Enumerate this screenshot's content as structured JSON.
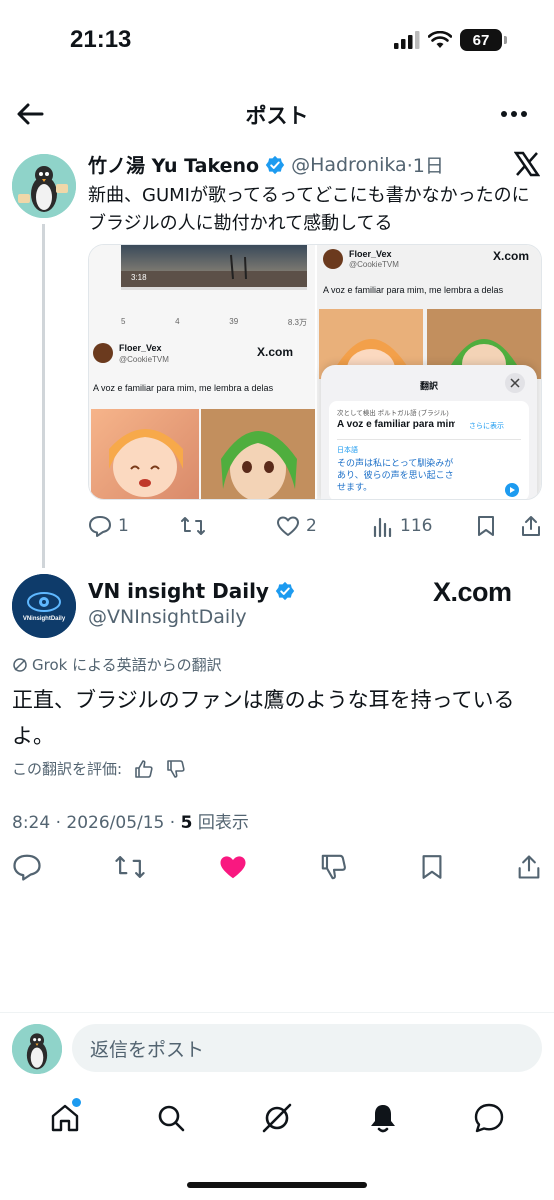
{
  "status_bar": {
    "time": "21:13",
    "battery": "67"
  },
  "header": {
    "title": "ポスト"
  },
  "tweet1": {
    "name": "竹ノ湯 Yu Takeno",
    "handle": "@Hadronika",
    "time": "·1日",
    "text": "新曲、GUMIが歌ってるってどこにも書かなかったのにブラジルの人に勘付かれて感動してる",
    "media": {
      "left": {
        "video_duration": "3:18",
        "stats": [
          "5",
          "4",
          "39",
          "8.3万"
        ],
        "quote_name": "Floer_Vex",
        "quote_handle": "@CookieTVM",
        "quote_brand": "X.com",
        "quote_text": "A voz e familiar para mim, me lembra a delas"
      },
      "right": {
        "quote_name": "Floer_Vex",
        "quote_handle": "@CookieTVM",
        "quote_brand": "X.com",
        "quote_text": "A voz e familiar para mim, me lembra a delas",
        "sheet_title": "翻訳",
        "source_lang": "次として検出 ポルトガル語 (ブラジル)",
        "source_text": "A voz e familiar para mim",
        "show_more": "さらに表示",
        "target_lang": "日本語",
        "target_text": "その声は私にとって馴染みがあり、彼らの声を思い起こさせます。"
      }
    },
    "actions": {
      "replies": "1",
      "reposts": "",
      "likes": "2",
      "views": "116"
    }
  },
  "tweet2": {
    "name": "VN insight Daily",
    "handle": "@VNInsightDaily",
    "brand_badge": "X.com",
    "avatar_text": "VNinsightDaily",
    "translated_by": "Grok による英語からの翻訳",
    "text": "正直、ブラジルのファンは鷹のような耳を持っているよ。",
    "rate_label": "この翻訳を評価:",
    "timestamp": "8:24 · 2026/05/15 · ",
    "view_count": "5",
    "view_label": "回表示"
  },
  "reply": {
    "placeholder": "返信をポスト"
  },
  "colors": {
    "accent": "#1d9bf0",
    "like": "#f91880",
    "text": "#0f1419",
    "secondary": "#536471"
  }
}
